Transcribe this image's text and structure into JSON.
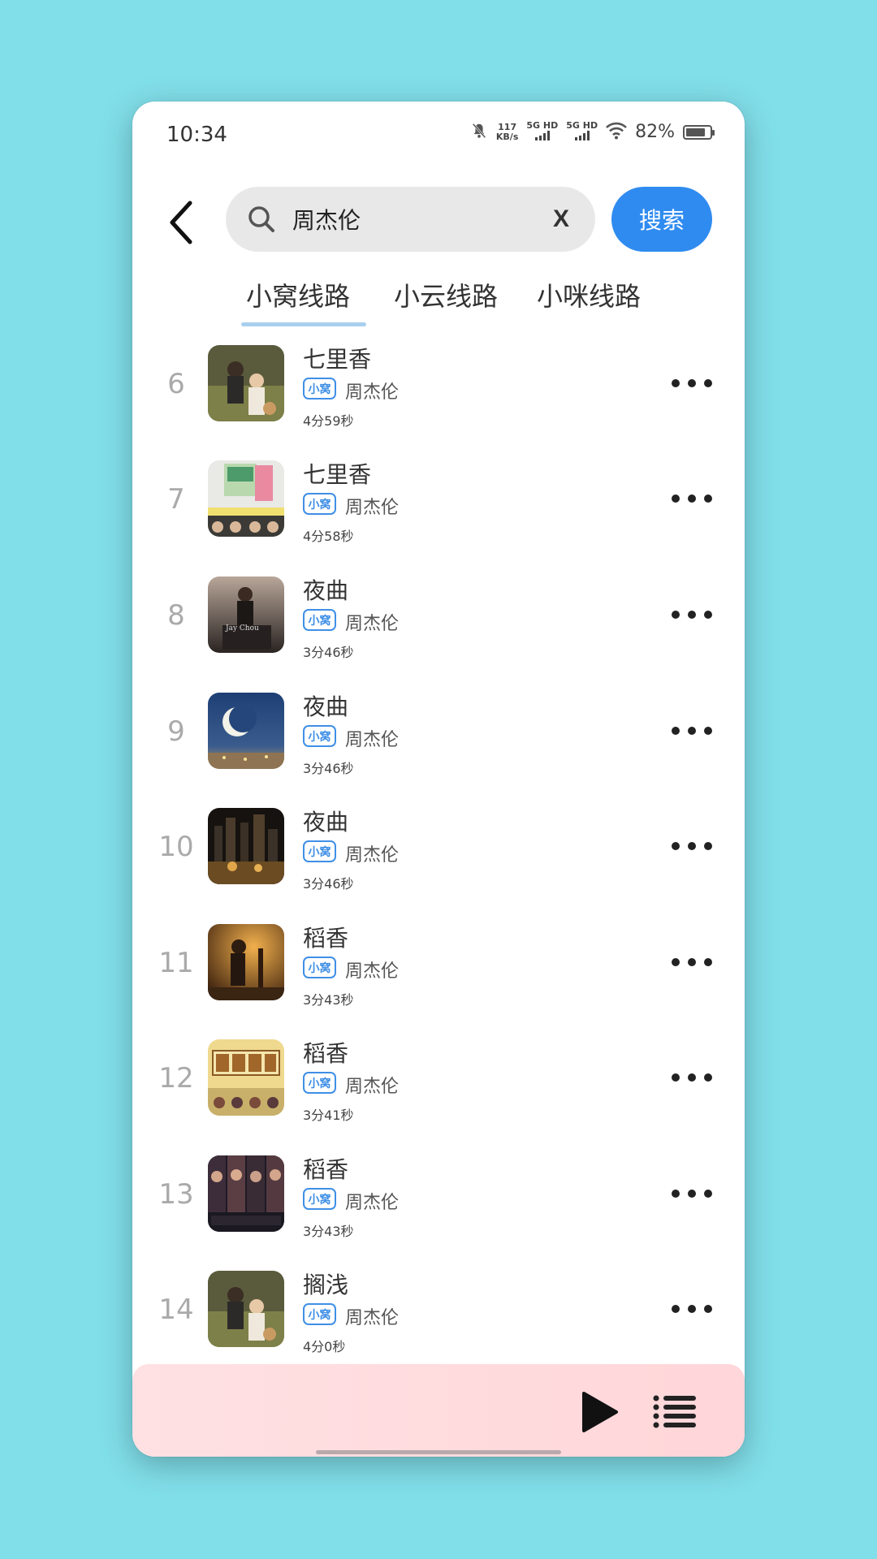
{
  "status_bar": {
    "time": "10:34",
    "net_speed_value": "117",
    "net_speed_unit": "KB/s",
    "sim1": "5G HD",
    "sim2": "5G HD",
    "battery": "82%"
  },
  "search": {
    "query": "周杰伦",
    "clear_label": "X",
    "button_label": "搜索"
  },
  "tabs": [
    {
      "label": "小窝线路",
      "active": true
    },
    {
      "label": "小云线路",
      "active": false
    },
    {
      "label": "小咪线路",
      "active": false
    }
  ],
  "songs": [
    {
      "index": "6",
      "title": "七里香",
      "source": "小窝",
      "artist": "周杰伦",
      "duration": "4分59秒"
    },
    {
      "index": "7",
      "title": "七里香",
      "source": "小窝",
      "artist": "周杰伦",
      "duration": "4分58秒"
    },
    {
      "index": "8",
      "title": "夜曲",
      "source": "小窝",
      "artist": "周杰伦",
      "duration": "3分46秒"
    },
    {
      "index": "9",
      "title": "夜曲",
      "source": "小窝",
      "artist": "周杰伦",
      "duration": "3分46秒"
    },
    {
      "index": "10",
      "title": "夜曲",
      "source": "小窝",
      "artist": "周杰伦",
      "duration": "3分46秒"
    },
    {
      "index": "11",
      "title": "稻香",
      "source": "小窝",
      "artist": "周杰伦",
      "duration": "3分43秒"
    },
    {
      "index": "12",
      "title": "稻香",
      "source": "小窝",
      "artist": "周杰伦",
      "duration": "3分41秒"
    },
    {
      "index": "13",
      "title": "稻香",
      "source": "小窝",
      "artist": "周杰伦",
      "duration": "3分43秒"
    },
    {
      "index": "14",
      "title": "搁浅",
      "source": "小窝",
      "artist": "周杰伦",
      "duration": "4分0秒"
    }
  ],
  "colors": {
    "background": "#81dfea",
    "accent": "#2f8bf0",
    "badge": "#3f8fe6",
    "player_bar": "#ffd6d9"
  },
  "icons": {
    "back": "back-arrow-icon",
    "search": "search-icon",
    "more": "more-dots-icon",
    "play": "play-icon",
    "playlist": "playlist-icon"
  }
}
